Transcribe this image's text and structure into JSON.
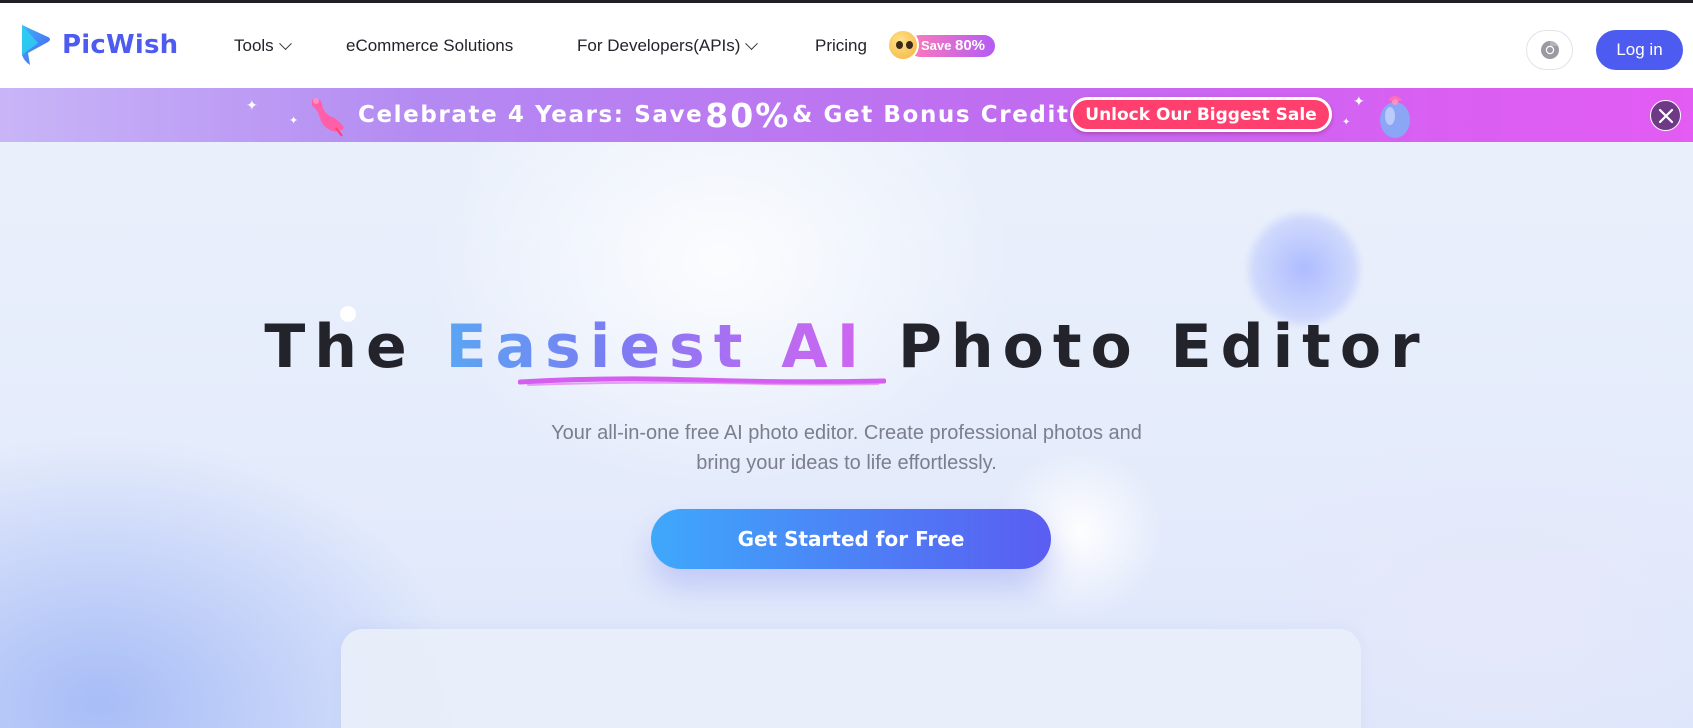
{
  "brand": {
    "name": "PicWish"
  },
  "nav": {
    "tools": "Tools",
    "ecommerce": "eCommerce Solutions",
    "developers": "For Developers(APIs)",
    "pricing": "Pricing",
    "save_badge_prefix": "Save",
    "save_badge_value": "80%"
  },
  "header": {
    "login_label": "Log in",
    "chrome_extension_icon": "chrome-icon"
  },
  "promo": {
    "text_before": "Celebrate 4 Years: Save",
    "percent": "80%",
    "text_after": "& Get Bonus Credits!",
    "button_label": "Unlock Our Biggest Sale",
    "close_icon": "close-icon"
  },
  "hero": {
    "title_part1": "The",
    "title_highlight": "Easiest AI",
    "title_part2": "Photo Editor",
    "subtitle_line1": "Your all-in-one free AI photo editor. Create professional photos and",
    "subtitle_line2": "bring your ideas to life effortlessly.",
    "cta_label": "Get Started for Free"
  },
  "colors": {
    "brand": "#4d5bf0",
    "text_dark": "#23232b",
    "subtitle": "#7b7e8c",
    "sale_button": "#ff3f6e"
  }
}
